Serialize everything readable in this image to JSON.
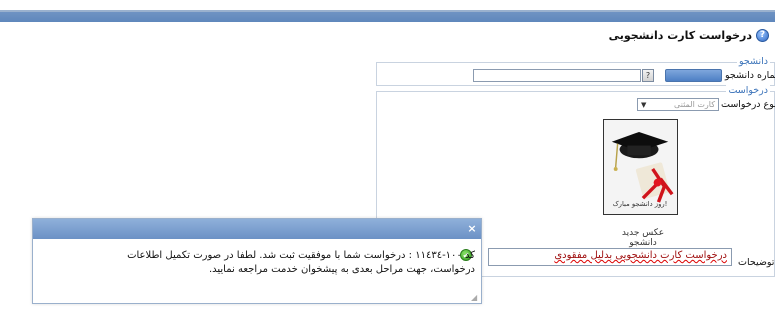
{
  "header": {
    "title": "درخواست کارت دانشجویی",
    "help_icon": "help-icon"
  },
  "student_section": {
    "legend": "دانشجو",
    "student_number_label": "شماره دانشجو",
    "lookup_button": "?"
  },
  "request_section": {
    "legend": "درخواست",
    "request_type_label": "نوع درخواست",
    "request_type_value": "کارت المثنی",
    "photo_caption": "عکس جدید دانشجو",
    "photo_overlay_text": "روز دانشجو مبارک!",
    "description_label": "توضیحات",
    "description_value": "درخواست کارت دانشجویی بدلیل مفقودی"
  },
  "dialog": {
    "close_glyph": "×",
    "message": "کد ۱۰۰-۱۱٤۳٤ : درخواست شما با موفقیت ثبت شد. لطفا در صورت تکمیل اطلاعات درخواست، جهت مراحل بعدی به پیشخوان خدمت مراجعه نمایید.",
    "status_icon": "success-check-icon",
    "resize_glyph": "◢"
  },
  "colors": {
    "top_bar": "#5f87bc",
    "legend_text": "#3b73b9",
    "dialog_title": "#6b91c5",
    "success": "#2f9a1b"
  }
}
